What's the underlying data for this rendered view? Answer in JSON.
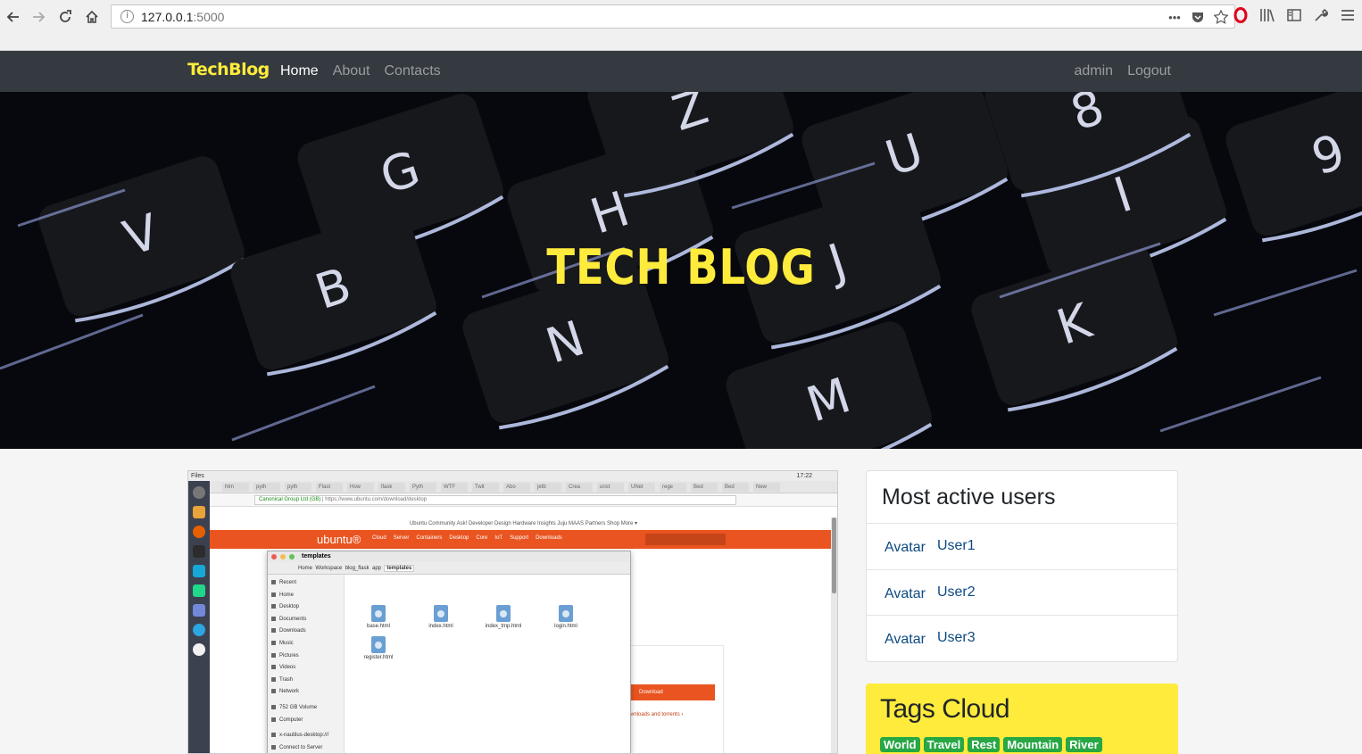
{
  "browser": {
    "url_host": "127.0.0.1",
    "url_port": ":5000"
  },
  "site": {
    "brand": "TechBlog",
    "nav": [
      "Home",
      "About",
      "Contacts"
    ],
    "user": "admin",
    "logout": "Logout",
    "hero_title": "TECH BLOG"
  },
  "hero_keys": [
    "G",
    "H",
    "V",
    "B",
    "N",
    "M",
    "U",
    "I",
    "J",
    "K",
    "Z",
    "8",
    "9"
  ],
  "post_image": {
    "topbar_app": "Files",
    "clock": "17:22",
    "tabs": [
      "htm",
      "pyth",
      "pyth",
      "Flast",
      "How",
      "flask",
      "Pyth",
      "WTF",
      "Twit",
      "Abo",
      "jetb",
      "Crea",
      "unst",
      "UNet",
      "rege",
      "Bed",
      "Bed",
      "New"
    ],
    "company": "Canonical Group Ltd (GB)",
    "url": "https://www.ubuntu.com/download/desktop",
    "subnav": "Ubuntu   Community   Ask!   Developer   Design   Hardware   Insights   Juju   MAAS   Partners   Shop   More ▾",
    "logo": "ubuntu®",
    "menu": [
      "Cloud",
      "Server",
      "Containers",
      "Desktop",
      "Core",
      "IoT",
      "Support",
      "Downloads"
    ],
    "download_btn": "Download",
    "download_link": "wnloads and torrents ›",
    "nautilus": {
      "title": "templates",
      "path": [
        "Home",
        "Workspace",
        "blog_flask",
        "app",
        "templates"
      ],
      "sidebar": [
        "Recent",
        "Home",
        "Desktop",
        "Documents",
        "Downloads",
        "Music",
        "Pictures",
        "Videos",
        "Trash",
        "Network",
        "752 GB Volume",
        "Computer",
        "x-nautilus-desktop:///",
        "Connect to Server"
      ],
      "files": [
        "base.html",
        "index.html",
        "index_tmp.html",
        "login.html",
        "register.html"
      ]
    }
  },
  "active_users": {
    "title": "Most active users",
    "users": [
      {
        "avatar": "Avatar",
        "name": "User1"
      },
      {
        "avatar": "Avatar",
        "name": "User2"
      },
      {
        "avatar": "Avatar",
        "name": "User3"
      }
    ]
  },
  "tags_cloud": {
    "title": "Tags Cloud",
    "tags": [
      "World",
      "Travel",
      "Rest",
      "Mountain",
      "River"
    ]
  },
  "colors": {
    "navbar": "#343a40",
    "brand_yellow": "#ffeb3b",
    "tag_green": "#28a745",
    "link_blue": "#0d4a82"
  }
}
